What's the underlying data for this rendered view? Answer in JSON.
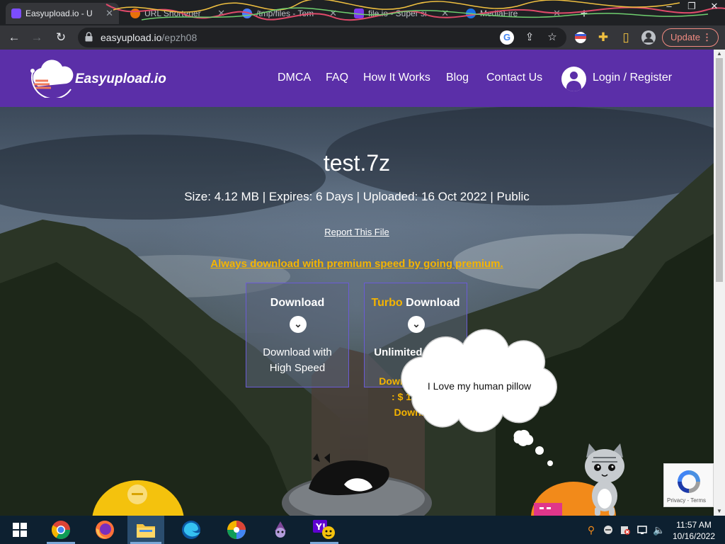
{
  "browser": {
    "tabs": [
      {
        "title": "Easyupload.io - U",
        "favicon_color": "#7c4dff",
        "active": true
      },
      {
        "title": "URL Shortener",
        "favicon_color": "#e8710a",
        "active": false
      },
      {
        "title": "/tmp/files - Tem",
        "favicon_color": "#4a7cff",
        "active": false
      },
      {
        "title": "file.io - Super si",
        "favicon_color": "#7c3aed",
        "active": false
      },
      {
        "title": "MediaFire",
        "favicon_color": "#1a73e8",
        "active": false
      }
    ],
    "new_tab_label": "+",
    "window_controls": [
      "–",
      "❐",
      "✕"
    ],
    "url": {
      "host": "easyupload.io",
      "path": "/epzh08"
    },
    "update_label": "Update"
  },
  "site": {
    "brand": "Easyupload.io",
    "nav": [
      "DMCA",
      "FAQ",
      "How It Works",
      "Blog",
      "Contact Us"
    ],
    "login_label": "Login / Register",
    "brand_color": "#5b2fa8"
  },
  "file": {
    "name": "test.7z",
    "meta": "Size: 4.12 MB | Expires: 6 Days | Uploaded: 16 Oct 2022 | Public",
    "report_label": "Report This File",
    "premium_link": "Always download with premium speed by going premium."
  },
  "download_cards": [
    {
      "title": "Download",
      "subtitle_line1": "Download with",
      "subtitle_line2": "High Speed"
    },
    {
      "title_accent": "Turbo",
      "title": "Download",
      "subtitle_line1": "Unlimited Speed",
      "subtitle_line2": ""
    }
  ],
  "turbo_price": {
    "line1": "Download Turbo",
    "line2": ": $ 1.99 Per",
    "line3": "Download"
  },
  "overlay": {
    "speech": "I Love my human pillow"
  },
  "recaptcha": {
    "privacy": "Privacy",
    "separator": " - ",
    "terms": "Terms"
  },
  "taskbar": {
    "apps": [
      {
        "name": "chrome",
        "running": true,
        "active": false
      },
      {
        "name": "firefox",
        "running": false,
        "active": false
      },
      {
        "name": "file-explorer",
        "running": true,
        "active": true
      },
      {
        "name": "edge",
        "running": false,
        "active": false
      },
      {
        "name": "photos",
        "running": false,
        "active": false
      },
      {
        "name": "tor",
        "running": false,
        "active": false
      },
      {
        "name": "yahoo-messenger",
        "running": true,
        "active": false
      }
    ],
    "time": "11:57 AM",
    "date": "10/16/2022"
  }
}
